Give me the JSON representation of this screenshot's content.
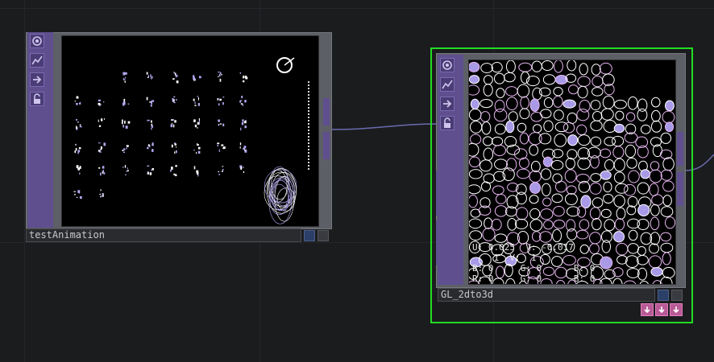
{
  "nodes": {
    "test_animation": {
      "name": "testAnimation"
    },
    "gl_2dto3d": {
      "name": "GL_2dto3d",
      "readout": {
        "line1": "U: 0.025  V: -0.017",
        "line2": "    1  V:  1",
        "line3": "B: 0     G: 0      B: 0",
        "line4": "R: 0     G: 0      B: 0"
      }
    }
  },
  "icons": {
    "sidebar": [
      "viewer-toggle-icon",
      "graph-icon",
      "arrow-right-icon",
      "lock-icon"
    ],
    "flags": [
      "down-arrow-icon",
      "down-arrow-icon",
      "down-arrow-icon"
    ]
  },
  "colors": {
    "background": "#1b1c1e",
    "sidebar": "#5f4f8f",
    "selection": "#22dd22",
    "wire": "#6b6bb0",
    "flag": "#b85a95"
  }
}
